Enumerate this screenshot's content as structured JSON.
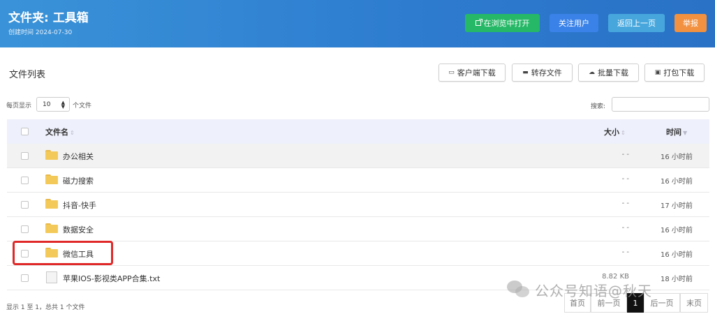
{
  "header": {
    "title": "文件夹: 工具箱",
    "created": "创建时间 2024-07-30",
    "buttons": {
      "open_browser": "在浏览中打开",
      "follow": "关注用户",
      "back": "返回上一页",
      "report": "举报"
    }
  },
  "section": {
    "title": "文件列表",
    "buttons": {
      "client_download": "客户端下载",
      "save": "转存文件",
      "batch_download": "批量下载",
      "pack_download": "打包下载"
    }
  },
  "controls": {
    "per_page_prefix": "每页显示",
    "per_page_value": "10",
    "per_page_suffix": "个文件",
    "search_label": "搜索:",
    "search_value": ""
  },
  "table": {
    "columns": {
      "name": "文件名",
      "size": "大小",
      "time": "时间"
    },
    "sort_icon": "⇕",
    "rows": [
      {
        "name": "办公相关",
        "size": "- -",
        "time": "16 小时前",
        "type": "folder"
      },
      {
        "name": "磁力搜索",
        "size": "- -",
        "time": "16 小时前",
        "type": "folder"
      },
      {
        "name": "抖音-快手",
        "size": "- -",
        "time": "17 小时前",
        "type": "folder"
      },
      {
        "name": "数据安全",
        "size": "- -",
        "time": "16 小时前",
        "type": "folder"
      },
      {
        "name": "微信工具",
        "size": "- -",
        "time": "16 小时前",
        "type": "folder"
      },
      {
        "name": "苹果IOS-影视类APP合集.txt",
        "size": "8.82 KB",
        "time": "18 小时前",
        "type": "file"
      }
    ]
  },
  "footer": {
    "info": "显示 1 至 1，总共 1 个文件",
    "pagination": {
      "first": "首页",
      "prev": "前一页",
      "current": "1",
      "next": "后一页",
      "last": "末页"
    }
  },
  "watermark": {
    "text": "公众号知语@秋天"
  },
  "colors": {
    "header": "#2d7bcf",
    "green": "#26b867",
    "blue": "#3b82e8",
    "light_blue": "#47a7dd",
    "orange": "#f29140",
    "highlight": "#e02828"
  }
}
